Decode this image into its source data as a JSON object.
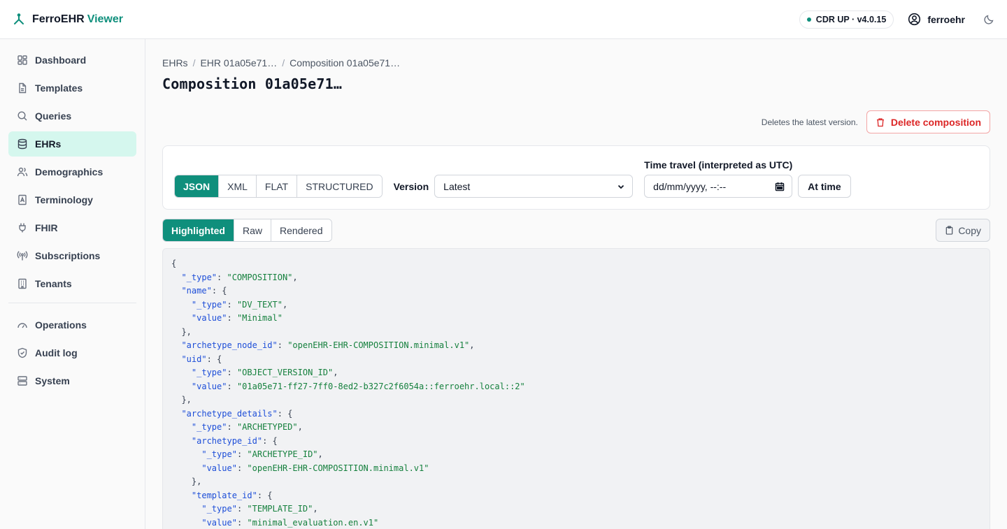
{
  "app": {
    "name": "FerroEHR",
    "name_accent": "Viewer"
  },
  "topbar": {
    "status": "CDR UP · v4.0.15",
    "user": "ferroehr"
  },
  "sidebar": {
    "items": [
      {
        "label": "Dashboard",
        "icon": "dashboard-icon"
      },
      {
        "label": "Templates",
        "icon": "file-icon"
      },
      {
        "label": "Queries",
        "icon": "search-icon"
      },
      {
        "label": "EHRs",
        "icon": "database-icon",
        "active": true
      },
      {
        "label": "Demographics",
        "icon": "users-icon"
      },
      {
        "label": "Terminology",
        "icon": "book-icon"
      },
      {
        "label": "FHIR",
        "icon": "plug-icon"
      },
      {
        "label": "Subscriptions",
        "icon": "broadcast-icon"
      },
      {
        "label": "Tenants",
        "icon": "building-icon"
      }
    ],
    "secondary_items": [
      {
        "label": "Operations",
        "icon": "gauge-icon"
      },
      {
        "label": "Audit log",
        "icon": "shield-icon"
      },
      {
        "label": "System",
        "icon": "server-icon"
      }
    ]
  },
  "breadcrumb": [
    "EHRs",
    "EHR 01a05e71…",
    "Composition 01a05e71…"
  ],
  "page": {
    "title": "Composition 01a05e71…"
  },
  "delete": {
    "hint": "Deletes the latest version.",
    "label": "Delete composition"
  },
  "formats": [
    "JSON",
    "XML",
    "FLAT",
    "STRUCTURED"
  ],
  "version": {
    "label": "Version",
    "selected": "Latest"
  },
  "time_travel": {
    "label": "Time travel (interpreted as UTC)",
    "placeholder": "dd/mm/yyyy, --:--",
    "button": "At time"
  },
  "views": [
    "Highlighted",
    "Raw",
    "Rendered"
  ],
  "copy_label": "Copy",
  "code_lines": [
    [
      [
        "p",
        "{"
      ]
    ],
    [
      [
        "p",
        "  "
      ],
      [
        "k",
        "\"_type\""
      ],
      [
        "p",
        ": "
      ],
      [
        "s",
        "\"COMPOSITION\""
      ],
      [
        "p",
        ","
      ]
    ],
    [
      [
        "p",
        "  "
      ],
      [
        "k",
        "\"name\""
      ],
      [
        "p",
        ": {"
      ]
    ],
    [
      [
        "p",
        "    "
      ],
      [
        "k",
        "\"_type\""
      ],
      [
        "p",
        ": "
      ],
      [
        "s",
        "\"DV_TEXT\""
      ],
      [
        "p",
        ","
      ]
    ],
    [
      [
        "p",
        "    "
      ],
      [
        "k",
        "\"value\""
      ],
      [
        "p",
        ": "
      ],
      [
        "s",
        "\"Minimal\""
      ]
    ],
    [
      [
        "p",
        "  },"
      ]
    ],
    [
      [
        "p",
        "  "
      ],
      [
        "k",
        "\"archetype_node_id\""
      ],
      [
        "p",
        ": "
      ],
      [
        "s",
        "\"openEHR-EHR-COMPOSITION.minimal.v1\""
      ],
      [
        "p",
        ","
      ]
    ],
    [
      [
        "p",
        "  "
      ],
      [
        "k",
        "\"uid\""
      ],
      [
        "p",
        ": {"
      ]
    ],
    [
      [
        "p",
        "    "
      ],
      [
        "k",
        "\"_type\""
      ],
      [
        "p",
        ": "
      ],
      [
        "s",
        "\"OBJECT_VERSION_ID\""
      ],
      [
        "p",
        ","
      ]
    ],
    [
      [
        "p",
        "    "
      ],
      [
        "k",
        "\"value\""
      ],
      [
        "p",
        ": "
      ],
      [
        "s",
        "\"01a05e71-ff27-7ff0-8ed2-b327c2f6054a::ferroehr.local::2\""
      ]
    ],
    [
      [
        "p",
        "  },"
      ]
    ],
    [
      [
        "p",
        "  "
      ],
      [
        "k",
        "\"archetype_details\""
      ],
      [
        "p",
        ": {"
      ]
    ],
    [
      [
        "p",
        "    "
      ],
      [
        "k",
        "\"_type\""
      ],
      [
        "p",
        ": "
      ],
      [
        "s",
        "\"ARCHETYPED\""
      ],
      [
        "p",
        ","
      ]
    ],
    [
      [
        "p",
        "    "
      ],
      [
        "k",
        "\"archetype_id\""
      ],
      [
        "p",
        ": {"
      ]
    ],
    [
      [
        "p",
        "      "
      ],
      [
        "k",
        "\"_type\""
      ],
      [
        "p",
        ": "
      ],
      [
        "s",
        "\"ARCHETYPE_ID\""
      ],
      [
        "p",
        ","
      ]
    ],
    [
      [
        "p",
        "      "
      ],
      [
        "k",
        "\"value\""
      ],
      [
        "p",
        ": "
      ],
      [
        "s",
        "\"openEHR-EHR-COMPOSITION.minimal.v1\""
      ]
    ],
    [
      [
        "p",
        "    },"
      ]
    ],
    [
      [
        "p",
        "    "
      ],
      [
        "k",
        "\"template_id\""
      ],
      [
        "p",
        ": {"
      ]
    ],
    [
      [
        "p",
        "      "
      ],
      [
        "k",
        "\"_type\""
      ],
      [
        "p",
        ": "
      ],
      [
        "s",
        "\"TEMPLATE_ID\""
      ],
      [
        "p",
        ","
      ]
    ],
    [
      [
        "p",
        "      "
      ],
      [
        "k",
        "\"value\""
      ],
      [
        "p",
        ": "
      ],
      [
        "s",
        "\"minimal_evaluation.en.v1\""
      ]
    ]
  ]
}
